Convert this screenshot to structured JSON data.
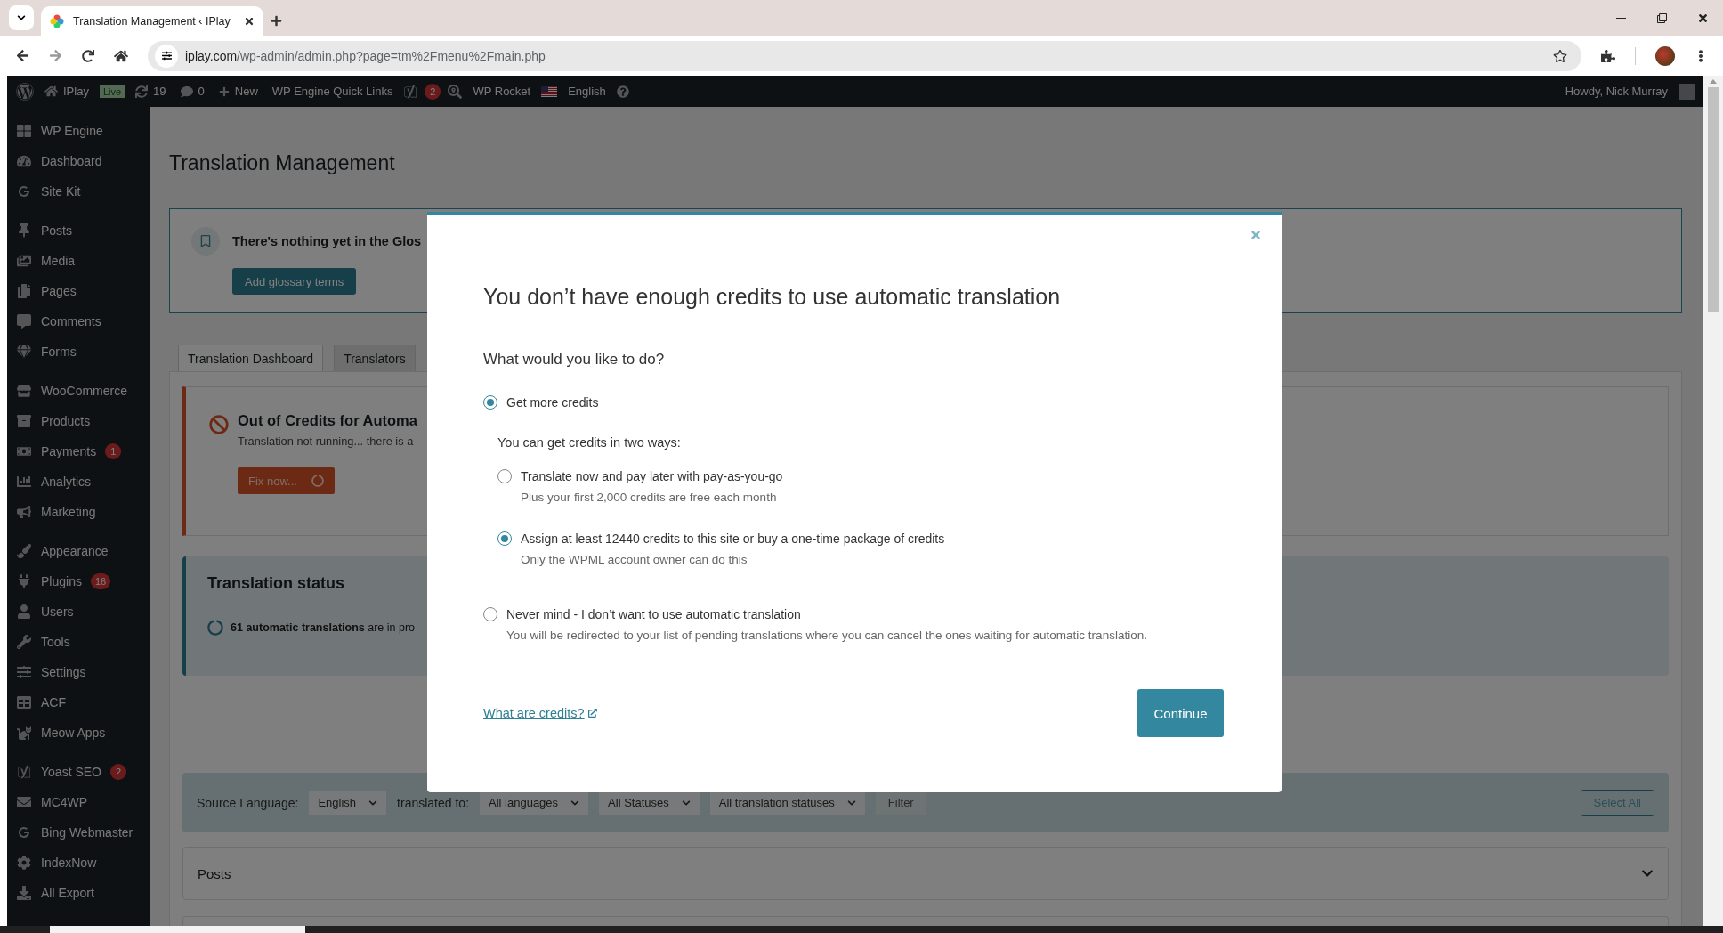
{
  "browser": {
    "tab_title": "Translation Management ‹ IPlay",
    "url_host": "iplay.com",
    "url_path": "/wp-admin/admin.php?page=tm%2Fmenu%2Fmain.php"
  },
  "admin_bar": {
    "site": "IPlay",
    "env": "Live",
    "updates": "19",
    "comments": "0",
    "new": "New",
    "quick_links": "WP Engine Quick Links",
    "yoast_count": "2",
    "rocket": "WP Rocket",
    "language": "English",
    "greeting": "Howdy, Nick Murray"
  },
  "sidebar": {
    "groups": [
      {
        "items": [
          {
            "label": "WP Engine"
          },
          {
            "label": "Dashboard"
          },
          {
            "label": "Site Kit"
          }
        ]
      },
      {
        "items": [
          {
            "label": "Posts"
          },
          {
            "label": "Media"
          },
          {
            "label": "Pages"
          },
          {
            "label": "Comments"
          },
          {
            "label": "Forms"
          }
        ]
      },
      {
        "items": [
          {
            "label": "WooCommerce"
          },
          {
            "label": "Products"
          },
          {
            "label": "Payments",
            "badge": "1"
          },
          {
            "label": "Analytics"
          },
          {
            "label": "Marketing"
          }
        ]
      },
      {
        "items": [
          {
            "label": "Appearance"
          },
          {
            "label": "Plugins",
            "badge": "16"
          },
          {
            "label": "Users"
          },
          {
            "label": "Tools"
          },
          {
            "label": "Settings"
          },
          {
            "label": "ACF"
          },
          {
            "label": "Meow Apps"
          }
        ]
      },
      {
        "items": [
          {
            "label": "Yoast SEO",
            "badge": "2"
          },
          {
            "label": "MC4WP"
          },
          {
            "label": "Bing Webmaster"
          },
          {
            "label": "IndexNow"
          },
          {
            "label": "All Export"
          }
        ]
      }
    ]
  },
  "page": {
    "title": "Translation Management",
    "glossary": {
      "text": "There's nothing yet in the Glos",
      "button": "Add glossary terms"
    },
    "tabs": [
      {
        "label": "Translation Dashboard",
        "selected": true
      },
      {
        "label": "Translators",
        "selected": false
      }
    ],
    "alert": {
      "title": "Out of Credits for Automa",
      "text": "Translation not running... there is a",
      "button": "Fix now..."
    },
    "status": {
      "title": "Translation status",
      "text": "**61 automatic translations** are in pro"
    },
    "filters": [
      {
        "kind": "label",
        "text": "Source Language:"
      },
      {
        "kind": "select",
        "text": "English"
      },
      {
        "kind": "label",
        "text": "translated to:"
      },
      {
        "kind": "select",
        "text": "All languages"
      },
      {
        "kind": "select",
        "text": "All Statuses"
      },
      {
        "kind": "select",
        "text": "All translation statuses"
      },
      {
        "kind": "button",
        "text": "Filter"
      }
    ],
    "select_all": "Select All",
    "sections": [
      {
        "title": "Posts"
      }
    ]
  },
  "modal": {
    "title": "You don’t have enough credits to use automatic translation",
    "question": "What would you like to do?",
    "options": [
      {
        "label": "Get more credits",
        "selected": true,
        "intro": "You can get credits in two ways:",
        "children": [
          {
            "label": "Translate now and pay later with pay-as-you-go",
            "description": "Plus your first 2,000 credits are free each month",
            "selected": false
          },
          {
            "label": "Assign at least 12440 credits to this site or buy a one-time package of credits",
            "description": "Only the WPML account owner can do this",
            "selected": true
          }
        ]
      },
      {
        "label": "Never mind - I don’t want to use automatic translation",
        "description": "You will be redirected to your list of pending translations where you can cancel the ones waiting for automatic translation.",
        "selected": false
      }
    ],
    "link": "What are credits?",
    "button": "Continue"
  }
}
